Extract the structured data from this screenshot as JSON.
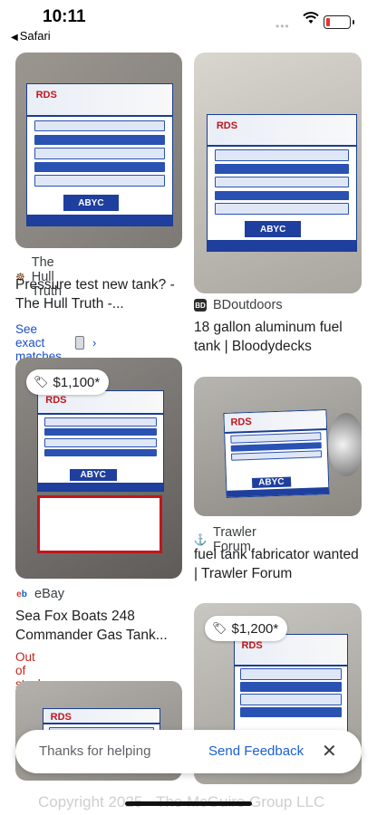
{
  "status": {
    "time": "10:11",
    "back_label": "Safari"
  },
  "results": [
    {
      "source": "The Hull Truth",
      "title": "Pressure test new tank? - The Hull Truth -...",
      "exact": "See exact matches",
      "icon": "helm-icon"
    },
    {
      "source": "BDoutdoors",
      "title": "18 gallon aluminum fuel tank | Bloodydecks",
      "icon": "bd-icon"
    },
    {
      "source": "eBay",
      "title": "Sea Fox Boats 248 Commander Gas Tank...",
      "price": "$1,100*",
      "status": "Out of stock",
      "icon": "ebay-icon"
    },
    {
      "source": "Trawler Forum",
      "title": "fuel tank fabricator wanted | Trawler Forum",
      "icon": "anchor-icon"
    },
    {
      "price": "$1,200*"
    }
  ],
  "plate_labels": {
    "brand": "RDS",
    "cert": "ABYC"
  },
  "feedback": {
    "thanks": "Thanks for helping",
    "send": "Send Feedback"
  },
  "footer": {
    "copyright": "Copyright 2025 - The McGuire Group LLC"
  },
  "colors": {
    "link": "#1a4fc9",
    "out_of_stock": "#c5221f",
    "plate_blue": "#1f3f9e"
  }
}
